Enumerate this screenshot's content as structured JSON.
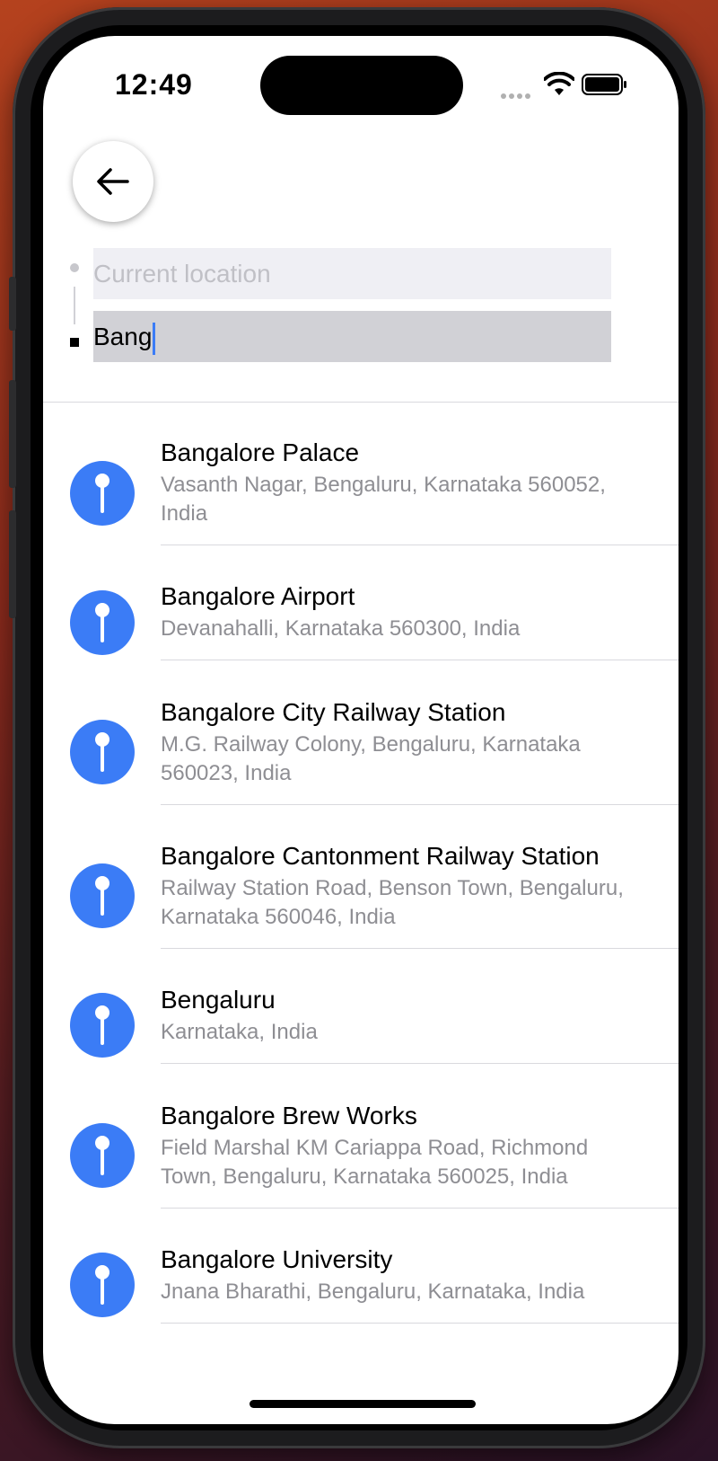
{
  "status_bar": {
    "time": "12:49"
  },
  "search": {
    "origin_placeholder": "Current location",
    "destination_value": "Bang"
  },
  "results": [
    {
      "title": "Bangalore Palace",
      "address": "Vasanth Nagar, Bengaluru, Karnataka 560052, India"
    },
    {
      "title": "Bangalore Airport",
      "address": "Devanahalli, Karnataka 560300, India"
    },
    {
      "title": "Bangalore City Railway Station",
      "address": "M.G. Railway Colony, Bengaluru, Karnataka 560023, India"
    },
    {
      "title": "Bangalore Cantonment Railway Station",
      "address": "Railway Station Road, Benson Town, Bengaluru, Karnataka 560046, India"
    },
    {
      "title": "Bengaluru",
      "address": "Karnataka, India"
    },
    {
      "title": "Bangalore Brew Works",
      "address": "Field Marshal KM Cariappa Road, Richmond Town, Bengaluru, Karnataka 560025, India"
    },
    {
      "title": "Bangalore University",
      "address": "Jnana Bharathi, Bengaluru, Karnataka, India"
    }
  ],
  "colors": {
    "accent": "#3b7cf6",
    "secondary_text": "#8e8e93"
  },
  "icons": {
    "back": "arrow-left-icon",
    "result": "map-pin-icon"
  }
}
